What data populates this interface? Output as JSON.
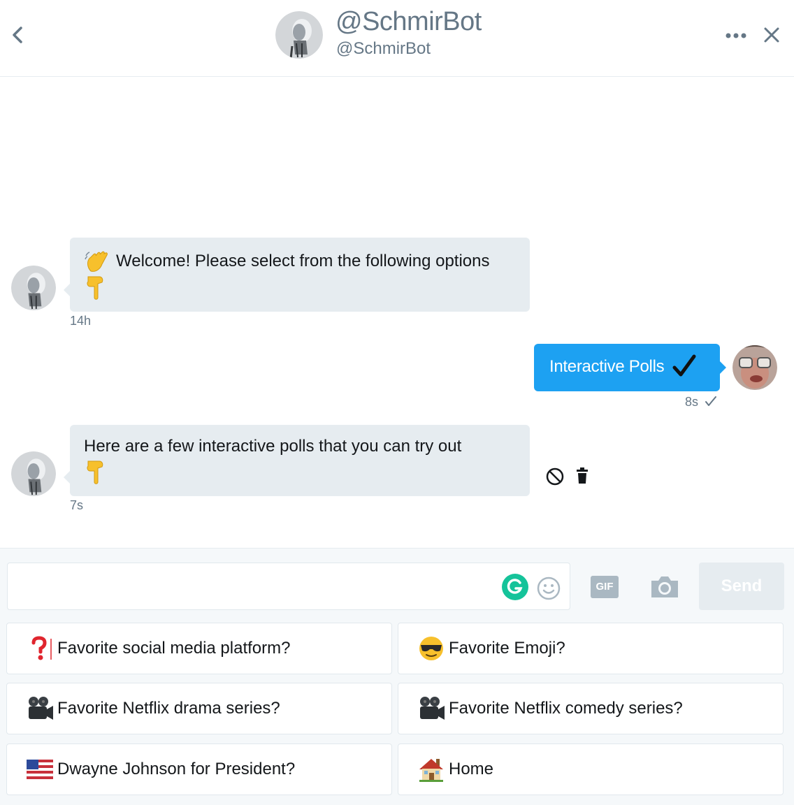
{
  "header": {
    "display_name": "@SchmirBot",
    "handle": "@SchmirBot"
  },
  "messages": [
    {
      "sender": "bot",
      "text": "Welcome! Please select from the following options",
      "timestamp": "14h"
    },
    {
      "sender": "user",
      "text": "Interactive Polls",
      "timestamp": "8s"
    },
    {
      "sender": "bot",
      "text": "Here are a few interactive polls that you can try out",
      "timestamp": "7s"
    }
  ],
  "composer": {
    "input_value": "",
    "gif_label": "GIF",
    "send_label": "Send"
  },
  "quick_replies": [
    {
      "label": "Favorite social media platform?",
      "icon": "question-mark-icon"
    },
    {
      "label": "Favorite Emoji?",
      "icon": "sunglasses-face-icon"
    },
    {
      "label": "Favorite Netflix drama series?",
      "icon": "movie-camera-icon"
    },
    {
      "label": "Favorite Netflix comedy series?",
      "icon": "movie-camera-icon"
    },
    {
      "label": "Dwayne Johnson for President?",
      "icon": "us-flag-icon"
    },
    {
      "label": "Home",
      "icon": "house-icon"
    }
  ],
  "colors": {
    "accent": "#1da1f2",
    "incoming_bubble": "#e6ecf0",
    "muted_text": "#657786"
  }
}
